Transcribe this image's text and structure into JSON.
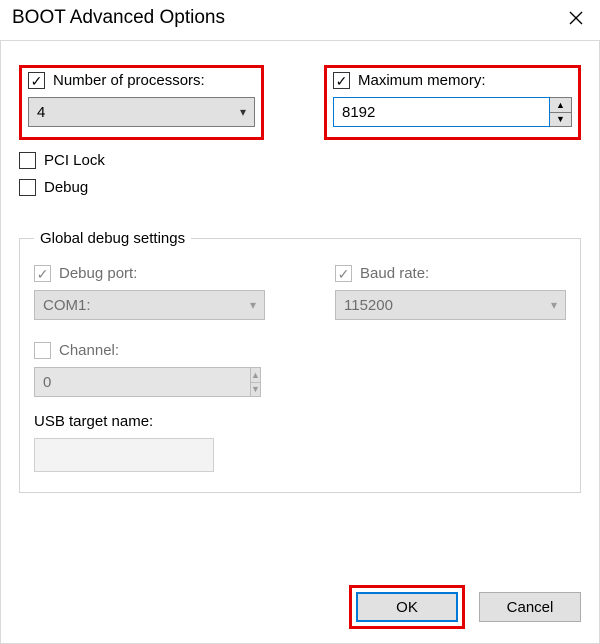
{
  "window": {
    "title": "BOOT Advanced Options"
  },
  "processors": {
    "label": "Number of processors:",
    "checked": true,
    "value": "4"
  },
  "memory": {
    "label": "Maximum memory:",
    "checked": true,
    "value": "8192"
  },
  "pci_lock": {
    "label": "PCI Lock",
    "checked": false
  },
  "debug": {
    "label": "Debug",
    "checked": false
  },
  "global_debug": {
    "legend": "Global debug settings",
    "debug_port": {
      "label": "Debug port:",
      "checked": true,
      "value": "COM1:"
    },
    "baud_rate": {
      "label": "Baud rate:",
      "checked": true,
      "value": "115200"
    },
    "channel": {
      "label": "Channel:",
      "checked": false,
      "value": "0"
    },
    "usb_target": {
      "label": "USB target name:",
      "value": ""
    }
  },
  "buttons": {
    "ok": "OK",
    "cancel": "Cancel"
  }
}
